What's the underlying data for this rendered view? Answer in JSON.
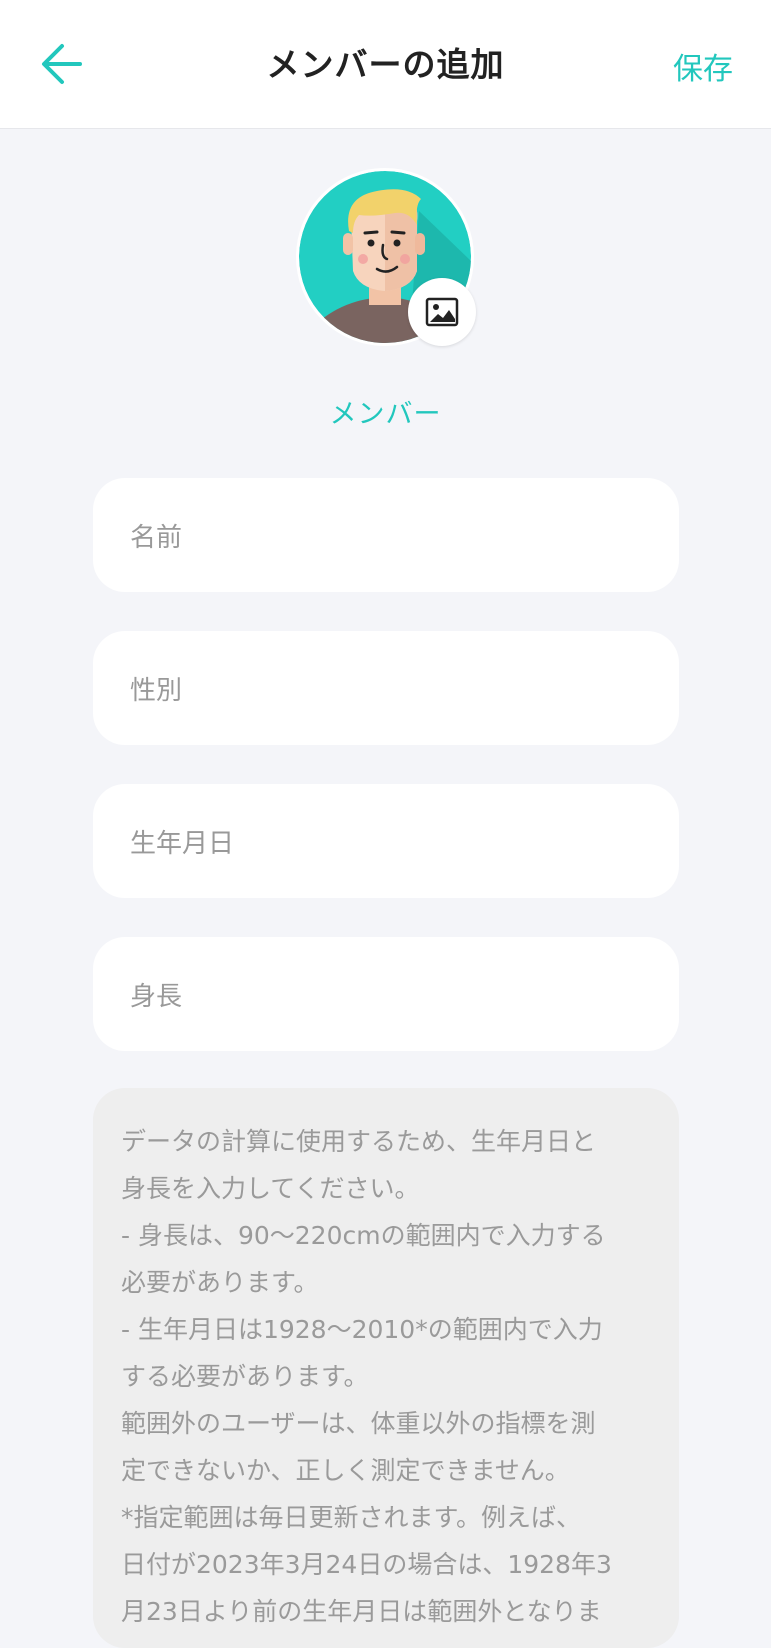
{
  "header": {
    "back_icon": "arrow-left-icon",
    "title": "メンバーの追加",
    "save_label": "保存"
  },
  "colors": {
    "accent": "#22c7bd",
    "background": "#f4f5f9",
    "field_bg": "#ffffff",
    "note_bg": "#eeeeee",
    "placeholder": "#999999"
  },
  "profile": {
    "avatar_icon": "avatar-illustration",
    "photo_icon": "image-icon",
    "role_label": "メンバー"
  },
  "form": {
    "name_placeholder": "名前",
    "gender_placeholder": "性別",
    "birthday_placeholder": "生年月日",
    "height_placeholder": "身長"
  },
  "note": {
    "lines": [
      "データの計算に使用するため、生年月日と",
      "身長を入力してください。",
      "- 身長は、90～220cmの範囲内で入力する",
      "必要があります。",
      "- 生年月日は1928～2010*の範囲内で入力",
      "する必要があります。",
      "範囲外のユーザーは、体重以外の指標を測",
      "定できないか、正しく測定できません。",
      "*指定範囲は毎日更新されます。例えば、",
      "日付が2023年3月24日の場合は、1928年3",
      "月23日より前の生年月日は範囲外となりま"
    ]
  }
}
